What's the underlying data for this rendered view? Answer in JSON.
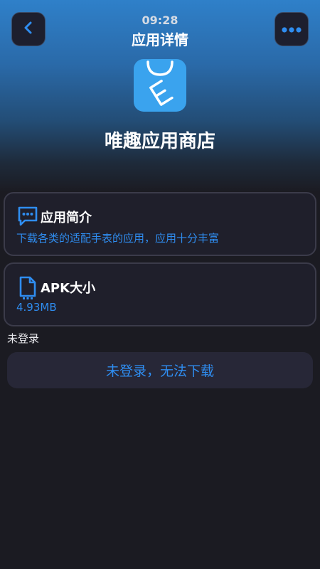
{
  "status_bar": {
    "time": "09:28"
  },
  "header": {
    "title": "应用详情",
    "back_icon": "chevron-left-icon",
    "more_icon": "more-dots-icon"
  },
  "app": {
    "name": "唯趣应用商店",
    "icon": "app-store-logo-icon",
    "icon_color": "#3aa3ee"
  },
  "intro_card": {
    "icon": "chat-bubble-icon",
    "title": "应用简介",
    "description": "下载各类的适配手表的应用，应用十分丰富"
  },
  "size_card": {
    "icon": "file-icon",
    "title": "APK大小",
    "value": "4.93MB"
  },
  "login_status": "未登录",
  "download_button": {
    "label": "未登录，无法下载"
  },
  "colors": {
    "accent": "#2f8df0",
    "background": "#1b1b22",
    "card": "#1f1f2b"
  }
}
